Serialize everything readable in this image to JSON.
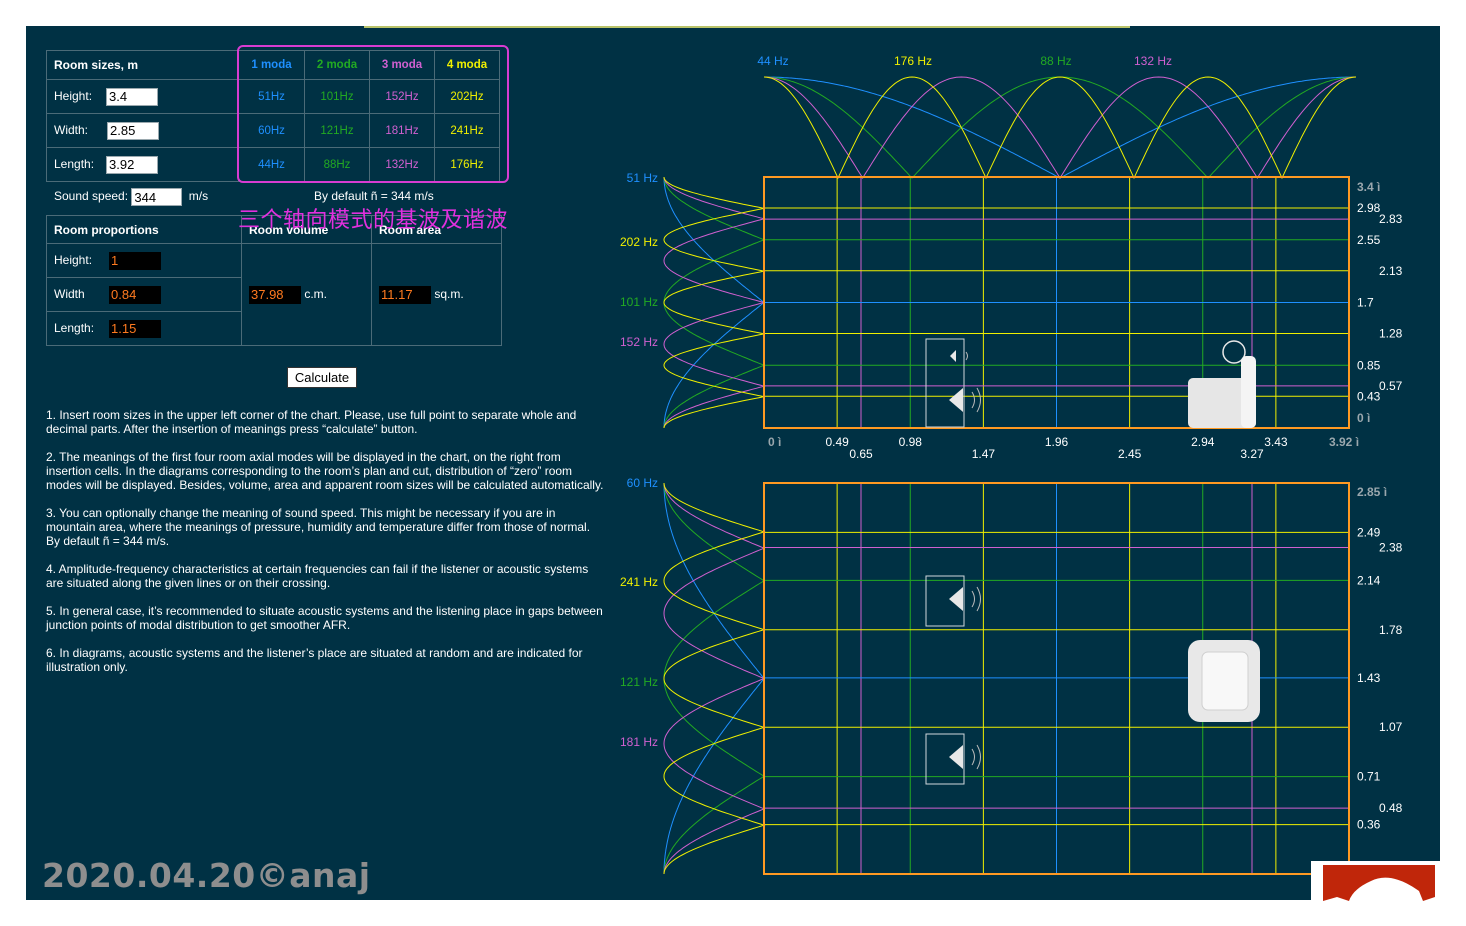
{
  "sizes": {
    "header": "Room sizes, m",
    "modes": [
      "1 moda",
      "2 moda",
      "3 moda",
      "4 moda"
    ],
    "mode_colors": [
      "#1e90ff",
      "#22aa22",
      "#d060d0",
      "#f0f000"
    ],
    "rows": [
      {
        "label": "Height:",
        "value": "3.4",
        "freqs": [
          "51Hz",
          "101Hz",
          "152Hz",
          "202Hz"
        ]
      },
      {
        "label": "Width:",
        "value": "2.85",
        "freqs": [
          "60Hz",
          "121Hz",
          "181Hz",
          "241Hz"
        ]
      },
      {
        "label": "Length:",
        "value": "3.92",
        "freqs": [
          "44Hz",
          "88Hz",
          "132Hz",
          "176Hz"
        ]
      }
    ]
  },
  "speed": {
    "label": "Sound speed:",
    "value": "344",
    "unit": "m/s",
    "default_note": "By default ñ = 344 m/s"
  },
  "annotation": "三个轴向模式的基波及谐波",
  "proportions": {
    "header": "Room proportions",
    "volume_header": "Room volume",
    "area_header": "Room area",
    "rows": [
      {
        "label": "Height:",
        "value": "1"
      },
      {
        "label": "Width",
        "value": "0.84"
      },
      {
        "label": "Length:",
        "value": "1.15"
      }
    ],
    "volume": "37.98",
    "volume_unit": "c.m.",
    "area": "11.17",
    "area_unit": "sq.m."
  },
  "calculate_label": "Calculate",
  "notes": [
    "1. Insert room sizes in the upper left corner of the chart. Please, use full point to separate whole and decimal parts. After the insertion of meanings press “calculate” button.",
    "2. The meanings of the first four room axial modes will be displayed in the chart, on the right from insertion cells. In the diagrams corresponding to the room’s plan and cut, distribution of “zero” room modes will be displayed. Besides, volume, area and apparent room sizes will be calculated automatically.",
    "3. You can optionally change the meaning of sound speed. This might be necessary if you are in mountain area, where the meanings of pressure, humidity and temperature differ from those of normal. By default ñ = 344 m/s.",
    "4. Amplitude-frequency characteristics at certain frequencies can fail if the listener or acoustic systems are situated along the given lines or on their crossing.",
    "5. In general case, it’s recommended to situate acoustic systems and the listening place in gaps between junction points of modal distribution to get smoother AFR.",
    "6. In diagrams, acoustic systems and the listener’s place are situated at random and are indicated for illustration only."
  ],
  "watermark": "2020.04.20©anaj",
  "top_freq_labels": [
    {
      "text": "44 Hz",
      "color": "#1e90ff"
    },
    {
      "text": "176 Hz",
      "color": "#f0f000"
    },
    {
      "text": "88 Hz",
      "color": "#22aa22"
    },
    {
      "text": "132 Hz",
      "color": "#d060d0"
    }
  ],
  "chart_cut": {
    "left_freq_labels": [
      {
        "text": "51 Hz",
        "color": "#1e90ff"
      },
      {
        "text": "202 Hz",
        "color": "#f0f000"
      },
      {
        "text": "101 Hz",
        "color": "#22aa22"
      },
      {
        "text": "152 Hz",
        "color": "#d060d0"
      }
    ],
    "x_max": 3.92,
    "y_max": 3.4,
    "x_lines": [
      {
        "v": 0.49,
        "label": "0.49",
        "color": "#f0f000"
      },
      {
        "v": 0.65,
        "label": "0.65",
        "color": "#d060d0"
      },
      {
        "v": 0.98,
        "label": "0.98",
        "color": "#22aa22"
      },
      {
        "v": 1.47,
        "label": "1.47",
        "color": "#f0f000"
      },
      {
        "v": 1.96,
        "label": "1.96",
        "color": "#1e90ff"
      },
      {
        "v": 2.45,
        "label": "2.45",
        "color": "#f0f000"
      },
      {
        "v": 2.94,
        "label": "2.94",
        "color": "#22aa22"
      },
      {
        "v": 3.27,
        "label": "3.27",
        "color": "#d060d0"
      },
      {
        "v": 3.43,
        "label": "3.43",
        "color": "#f0f000"
      }
    ],
    "x_end_labels": [
      "0 ì",
      "3.92 ì"
    ],
    "y_lines": [
      {
        "v": 2.98,
        "label": "2.98",
        "color": "#f0f000"
      },
      {
        "v": 2.83,
        "label": "2.83",
        "color": "#d060d0"
      },
      {
        "v": 2.55,
        "label": "2.55",
        "color": "#22aa22"
      },
      {
        "v": 2.13,
        "label": "2.13",
        "color": "#f0f000"
      },
      {
        "v": 1.7,
        "label": "1.7",
        "color": "#1e90ff"
      },
      {
        "v": 1.28,
        "label": "1.28",
        "color": "#f0f000"
      },
      {
        "v": 0.85,
        "label": "0.85",
        "color": "#22aa22"
      },
      {
        "v": 0.57,
        "label": "0.57",
        "color": "#d060d0"
      },
      {
        "v": 0.43,
        "label": "0.43",
        "color": "#f0f000"
      }
    ],
    "y_end_labels": [
      "3.4 ì",
      "0 ì"
    ]
  },
  "chart_plan": {
    "left_freq_labels": [
      {
        "text": "60 Hz",
        "color": "#1e90ff"
      },
      {
        "text": "241 Hz",
        "color": "#f0f000"
      },
      {
        "text": "121 Hz",
        "color": "#22aa22"
      },
      {
        "text": "181 Hz",
        "color": "#d060d0"
      }
    ],
    "y_max": 2.85,
    "y_lines": [
      {
        "v": 2.49,
        "label": "2.49",
        "color": "#f0f000"
      },
      {
        "v": 2.38,
        "label": "2.38",
        "color": "#d060d0"
      },
      {
        "v": 2.14,
        "label": "2.14",
        "color": "#22aa22"
      },
      {
        "v": 1.78,
        "label": "1.78",
        "color": "#f0f000"
      },
      {
        "v": 1.43,
        "label": "1.43",
        "color": "#1e90ff"
      },
      {
        "v": 1.07,
        "label": "1.07",
        "color": "#f0f000"
      },
      {
        "v": 0.71,
        "label": "0.71",
        "color": "#22aa22"
      },
      {
        "v": 0.48,
        "label": "0.48",
        "color": "#d060d0"
      },
      {
        "v": 0.36,
        "label": "0.36",
        "color": "#f0f000"
      }
    ],
    "y_end_label": "2.85 ì"
  },
  "colors": {
    "background": "#003144",
    "frame": "#ff9922",
    "accent": "#d83cd1",
    "logo": "#c0260a"
  }
}
